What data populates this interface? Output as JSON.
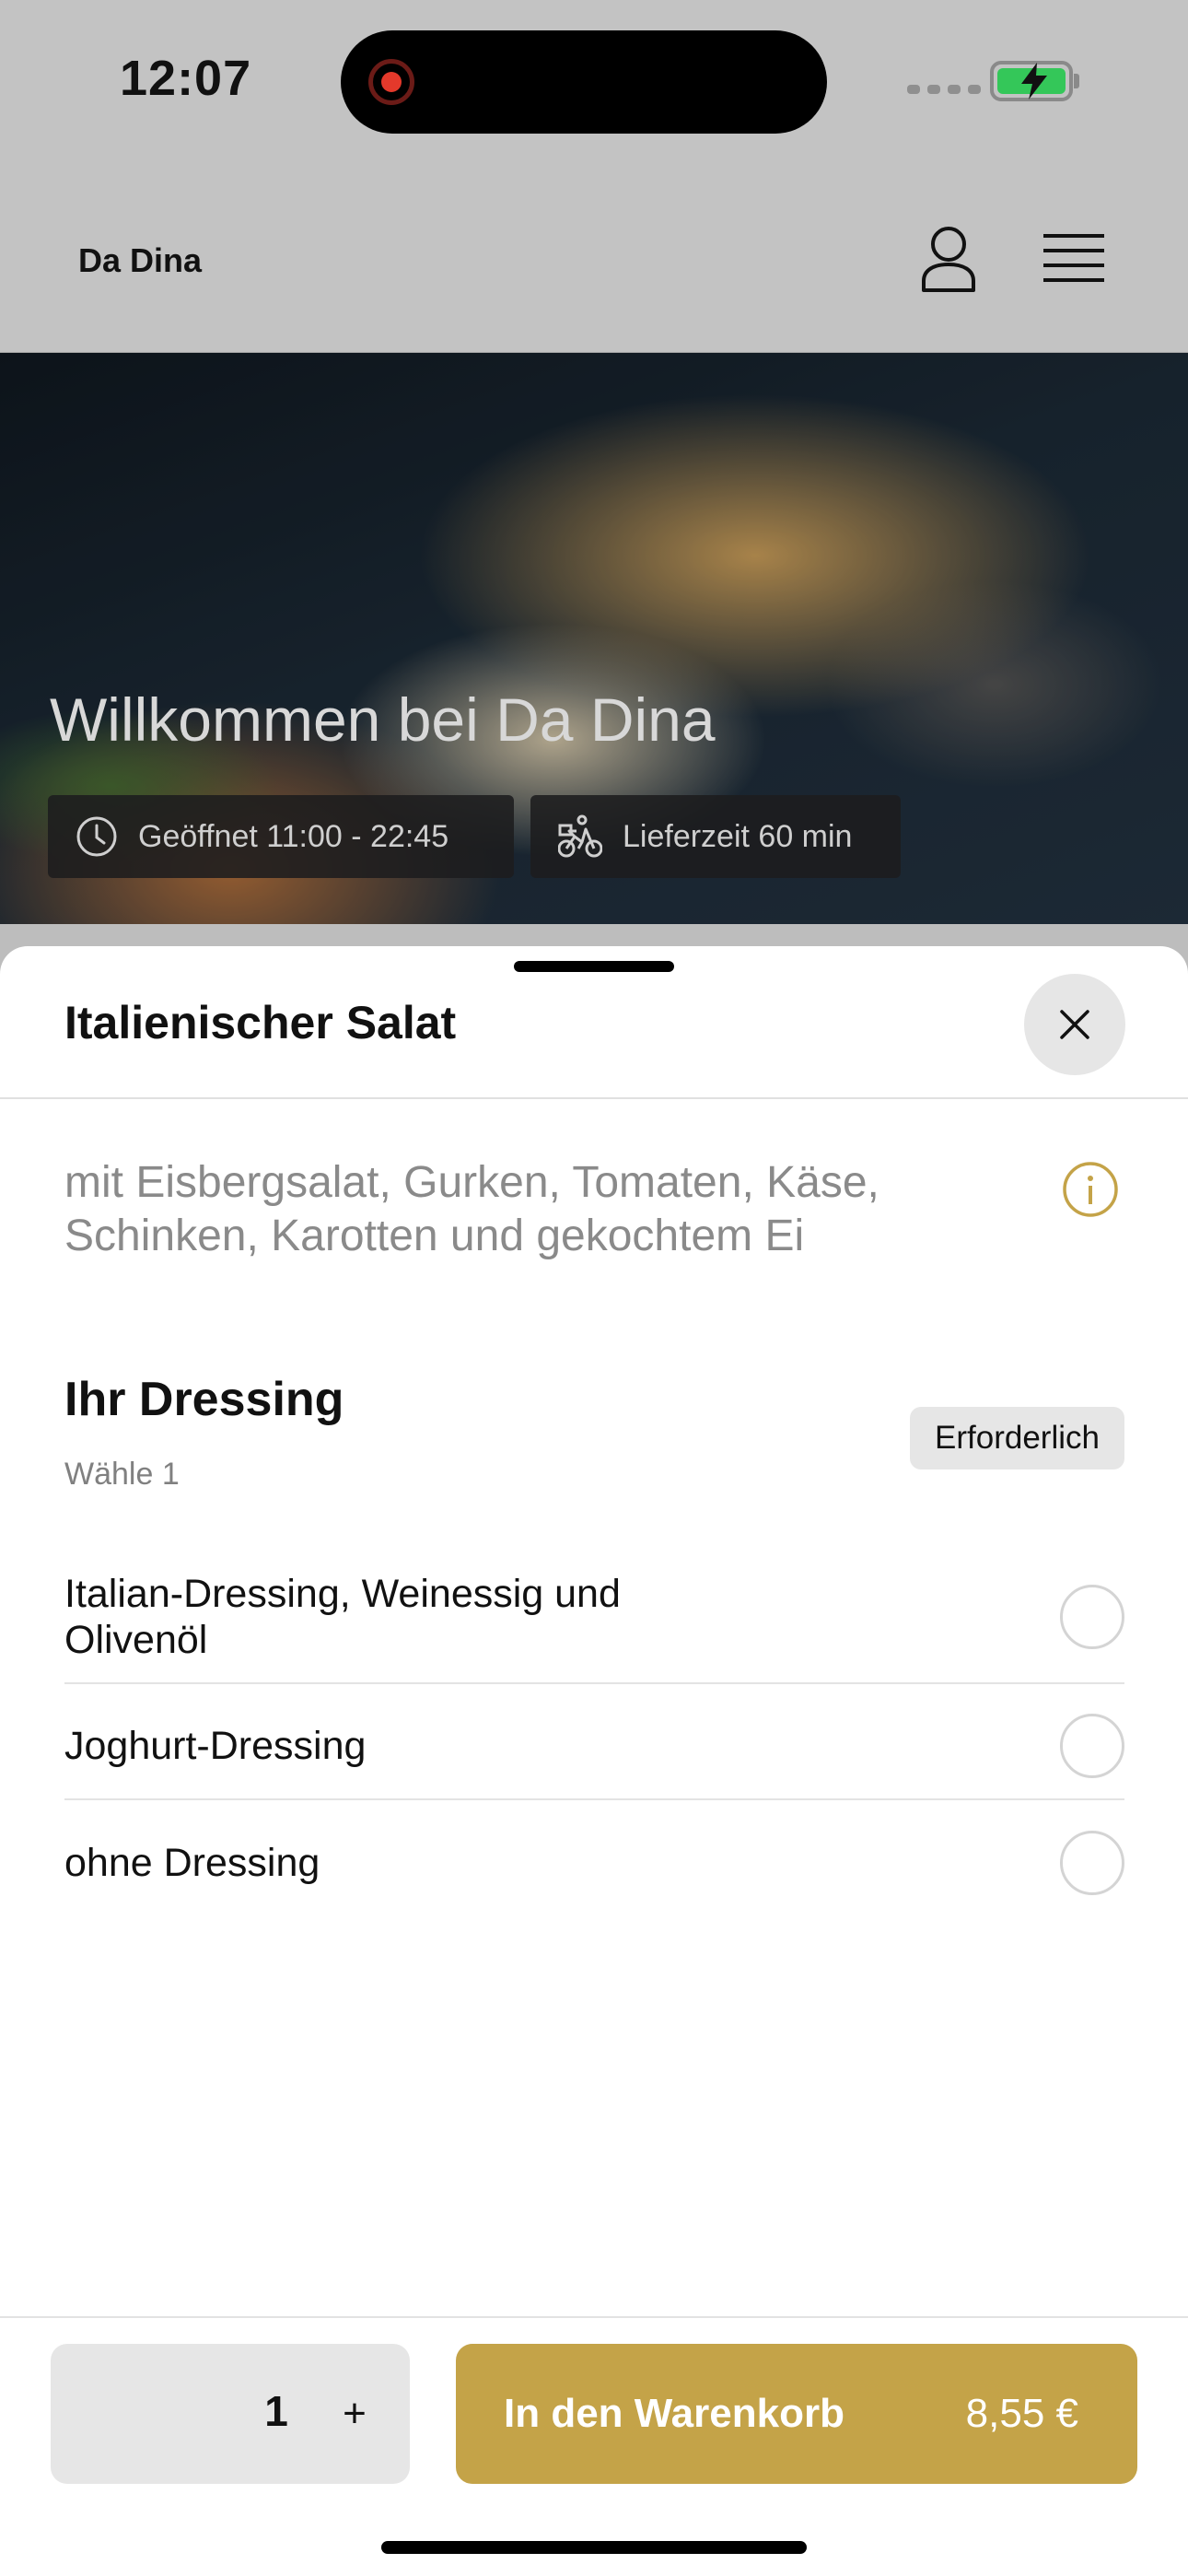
{
  "status_bar": {
    "time": "12:07"
  },
  "header": {
    "brand": "Da Dina",
    "icons": [
      "user-icon",
      "menu-icon"
    ]
  },
  "hero": {
    "title": "Willkommen bei Da Dina",
    "opening_hours": "Geöffnet 11:00 - 22:45",
    "delivery_time": "Lieferzeit 60 min"
  },
  "sheet": {
    "title": "Italienischer Salat",
    "description": "mit Eisbergsalat, Gurken, Tomaten, Käse, Schinken, Karotten und gekochtem Ei",
    "option_group": {
      "title": "Ihr Dressing",
      "subtitle": "Wähle 1",
      "badge": "Erforderlich",
      "options": [
        {
          "label": "Italian-Dressing, Weinessig und Olivenöl",
          "selected": false
        },
        {
          "label": "Joghurt-Dressing",
          "selected": false
        },
        {
          "label": "ohne Dressing",
          "selected": false
        }
      ]
    }
  },
  "footer": {
    "quantity": "1",
    "plus_label": "+",
    "cart_label": "In den Warenkorb",
    "price": "8,55 €"
  },
  "colors": {
    "accent": "#c4a348",
    "header_bg": "#c3c3c3",
    "battery_green": "#34c759",
    "recording_red": "#e4392b"
  }
}
